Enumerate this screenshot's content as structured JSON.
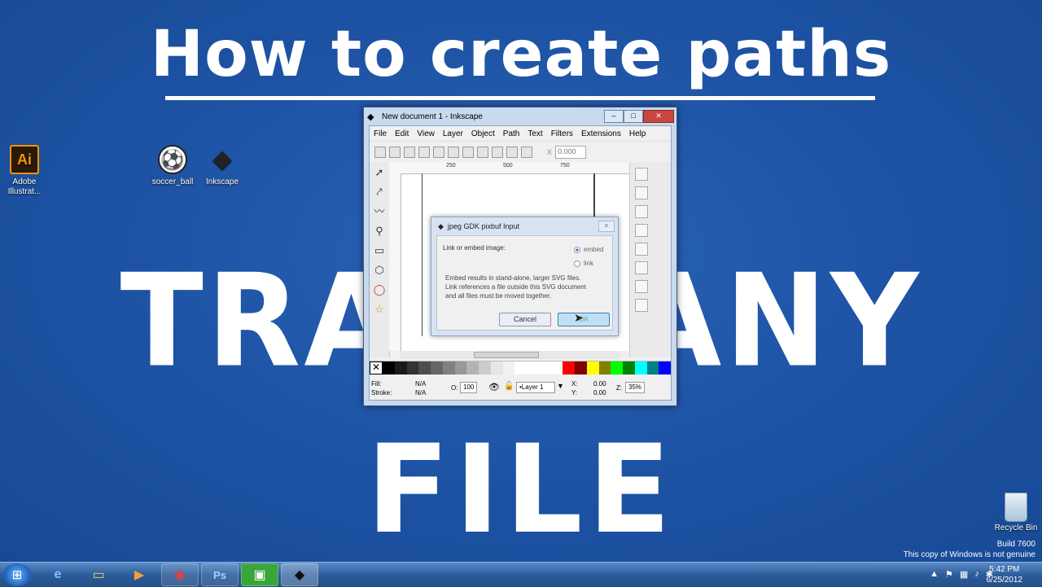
{
  "overlay": {
    "title": "How to create paths",
    "line2": "TRACE ANY",
    "line3": "FILE"
  },
  "desktop_icons": [
    {
      "label": "Adobe Illustrat...",
      "icon": "illustrator-icon",
      "glyph": "Ai"
    },
    {
      "label": "soccer_ball",
      "icon": "soccer-ball-icon",
      "glyph": "⚽"
    },
    {
      "label": "Inkscape",
      "icon": "inkscape-icon",
      "glyph": "◆"
    }
  ],
  "window": {
    "title": "New document 1 - Inkscape",
    "controls": {
      "minimize": "–",
      "maximize": "□",
      "close": "✕"
    },
    "menu": [
      "File",
      "Edit",
      "View",
      "Layer",
      "Object",
      "Path",
      "Text",
      "Filters",
      "Extensions",
      "Help"
    ],
    "x_label": "X",
    "x_value": "0.000",
    "ruler": [
      "250",
      "500",
      "750"
    ],
    "status": {
      "fill_label": "Fill:",
      "fill_value": "N/A",
      "stroke_label": "Stroke:",
      "stroke_value": "N/A",
      "opacity_label": "O:",
      "opacity_value": "100",
      "layer": "•Layer 1",
      "x_label": "X:",
      "x_value": "0.00",
      "y_label": "Y:",
      "y_value": "0.00",
      "z_label": "Z:",
      "zoom": "35%"
    },
    "palette": [
      "#000000",
      "#1a1a1a",
      "#333333",
      "#4d4d4d",
      "#666666",
      "#808080",
      "#999999",
      "#b3b3b3",
      "#cccccc",
      "#e6e6e6",
      "#f2f2f2",
      "#ffffff",
      "#ffffff",
      "#ffffff",
      "#ffffff",
      "#ff0000",
      "#800000",
      "#ffff00",
      "#808000",
      "#00ff00",
      "#008000",
      "#00ffff",
      "#008080",
      "#0000ff"
    ]
  },
  "dialog": {
    "title": "jpeg GDK pixbuf Input",
    "prompt": "Link or embed image:",
    "options": [
      {
        "label": "embed",
        "selected": true
      },
      {
        "label": "link",
        "selected": false
      }
    ],
    "description_1": "Embed results in stand-alone, larger SVG files.",
    "description_2": "Link references a file outside this SVG document",
    "description_3": "and all files must be moved together.",
    "cancel": "Cancel",
    "ok": "OK"
  },
  "recycle_bin": "Recycle Bin",
  "watermark": {
    "build": "Build 7600",
    "notice": "This copy of Windows is not genuine"
  },
  "taskbar": {
    "apps": [
      {
        "name": "ie",
        "glyph": "e"
      },
      {
        "name": "explorer",
        "glyph": "▭"
      },
      {
        "name": "media-player",
        "glyph": "▶"
      },
      {
        "name": "chrome",
        "glyph": "◉"
      },
      {
        "name": "photoshop",
        "glyph": "Ps"
      },
      {
        "name": "camtasia",
        "glyph": "▣"
      },
      {
        "name": "inkscape",
        "glyph": "◆"
      }
    ],
    "time": "5:42 PM",
    "date": "6/25/2012"
  },
  "colors": {
    "desktop": "#1f55a6",
    "accent": "#3c7fb1"
  }
}
